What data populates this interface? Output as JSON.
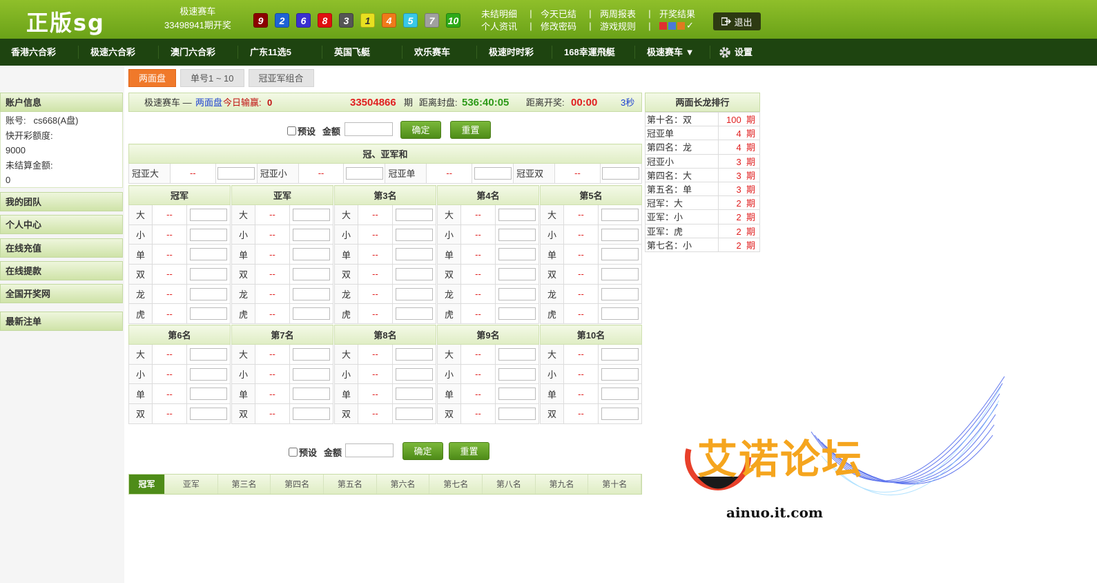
{
  "header": {
    "logo": "正版sg",
    "game_name": "极速赛车",
    "last_draw": "33498941期开奖",
    "balls": [
      {
        "n": "9",
        "color": "#8b0000"
      },
      {
        "n": "2",
        "color": "#1e63d6"
      },
      {
        "n": "6",
        "color": "#3a2fd0"
      },
      {
        "n": "8",
        "color": "#e01010"
      },
      {
        "n": "3",
        "color": "#555555"
      },
      {
        "n": "1",
        "color": "#e8e020"
      },
      {
        "n": "4",
        "color": "#f07a1a"
      },
      {
        "n": "5",
        "color": "#38c8e8"
      },
      {
        "n": "7",
        "color": "#a0a0a0"
      },
      {
        "n": "10",
        "color": "#2eaa18"
      }
    ],
    "links_row1": [
      "未结明细",
      "今天已结",
      "两周报表",
      "开奖结果"
    ],
    "links_row2": [
      "个人资讯",
      "修改密码",
      "游戏规则"
    ],
    "separator": "|",
    "checkmark": "✓",
    "logout": "退出"
  },
  "nav": [
    "香港六合彩",
    "极速六合彩",
    "澳门六合彩",
    "广东11选5",
    "英国飞艇",
    "欢乐赛车",
    "极速时时彩",
    "168幸運飛艇",
    "极速赛车 ▼"
  ],
  "nav_settings": "设置",
  "sidebar": {
    "account_title": "账户信息",
    "account_label": "账号:",
    "account_value": "cs668(A盘)",
    "quota_label": "快开彩额度:",
    "quota_value": "9000",
    "unsettled_label": "未结算金额:",
    "unsettled_value": "0",
    "menu": [
      "我的团队",
      "个人中心",
      "在线充值",
      "在线提款",
      "全国开奖网",
      "最新注单"
    ]
  },
  "tabs": [
    "两面盘",
    "单号1 ~ 10",
    "冠亚军组合"
  ],
  "infobar": {
    "game": "极速赛车 —",
    "mode": "两面盘",
    "profit_label": "今日输赢:",
    "profit_value": "0",
    "period": "33504866",
    "period_suffix": "期",
    "close_label": "距离封盘:",
    "close_value": "536:40:05",
    "open_label": "距离开奖:",
    "open_value": "00:00",
    "refresh": "3秒"
  },
  "controls": {
    "preset": "预设",
    "amount": "金额",
    "confirm": "确定",
    "reset": "重置"
  },
  "sum_section": {
    "title": "冠、亚军和",
    "items": [
      "冠亚大",
      "冠亚小",
      "冠亚单",
      "冠亚双"
    ]
  },
  "odds_placeholder": "--",
  "group1": {
    "titles": [
      "冠军",
      "亚军",
      "第3名",
      "第4名",
      "第5名"
    ],
    "rows": [
      "大",
      "小",
      "单",
      "双",
      "龙",
      "虎"
    ]
  },
  "group2": {
    "titles": [
      "第6名",
      "第7名",
      "第8名",
      "第9名",
      "第10名"
    ],
    "rows": [
      "大",
      "小",
      "单",
      "双"
    ]
  },
  "ranking": {
    "title": "两面长龙排行",
    "unit": "期",
    "items": [
      {
        "name": "第十名：双",
        "count": "100"
      },
      {
        "name": "冠亚单",
        "count": "4"
      },
      {
        "name": "第四名：龙",
        "count": "4"
      },
      {
        "name": "冠亚小",
        "count": "3"
      },
      {
        "name": "第四名：大",
        "count": "3"
      },
      {
        "name": "第五名：单",
        "count": "3"
      },
      {
        "name": "冠军：大",
        "count": "2"
      },
      {
        "name": "亚军：小",
        "count": "2"
      },
      {
        "name": "亚军：虎",
        "count": "2"
      },
      {
        "name": "第七名：小",
        "count": "2"
      }
    ]
  },
  "bottom_tabs": [
    "冠军",
    "亚军",
    "第三名",
    "第四名",
    "第五名",
    "第六名",
    "第七名",
    "第八名",
    "第九名",
    "第十名"
  ],
  "watermark": {
    "title": "艾诺论坛",
    "url": "ainuo.it.com"
  },
  "colors": {
    "header_green": "#7ab022",
    "nav_dark": "#1e4410",
    "active_tab": "#f0792a",
    "odds_red": "#e02020",
    "close_time_green": "#2e9a18"
  }
}
